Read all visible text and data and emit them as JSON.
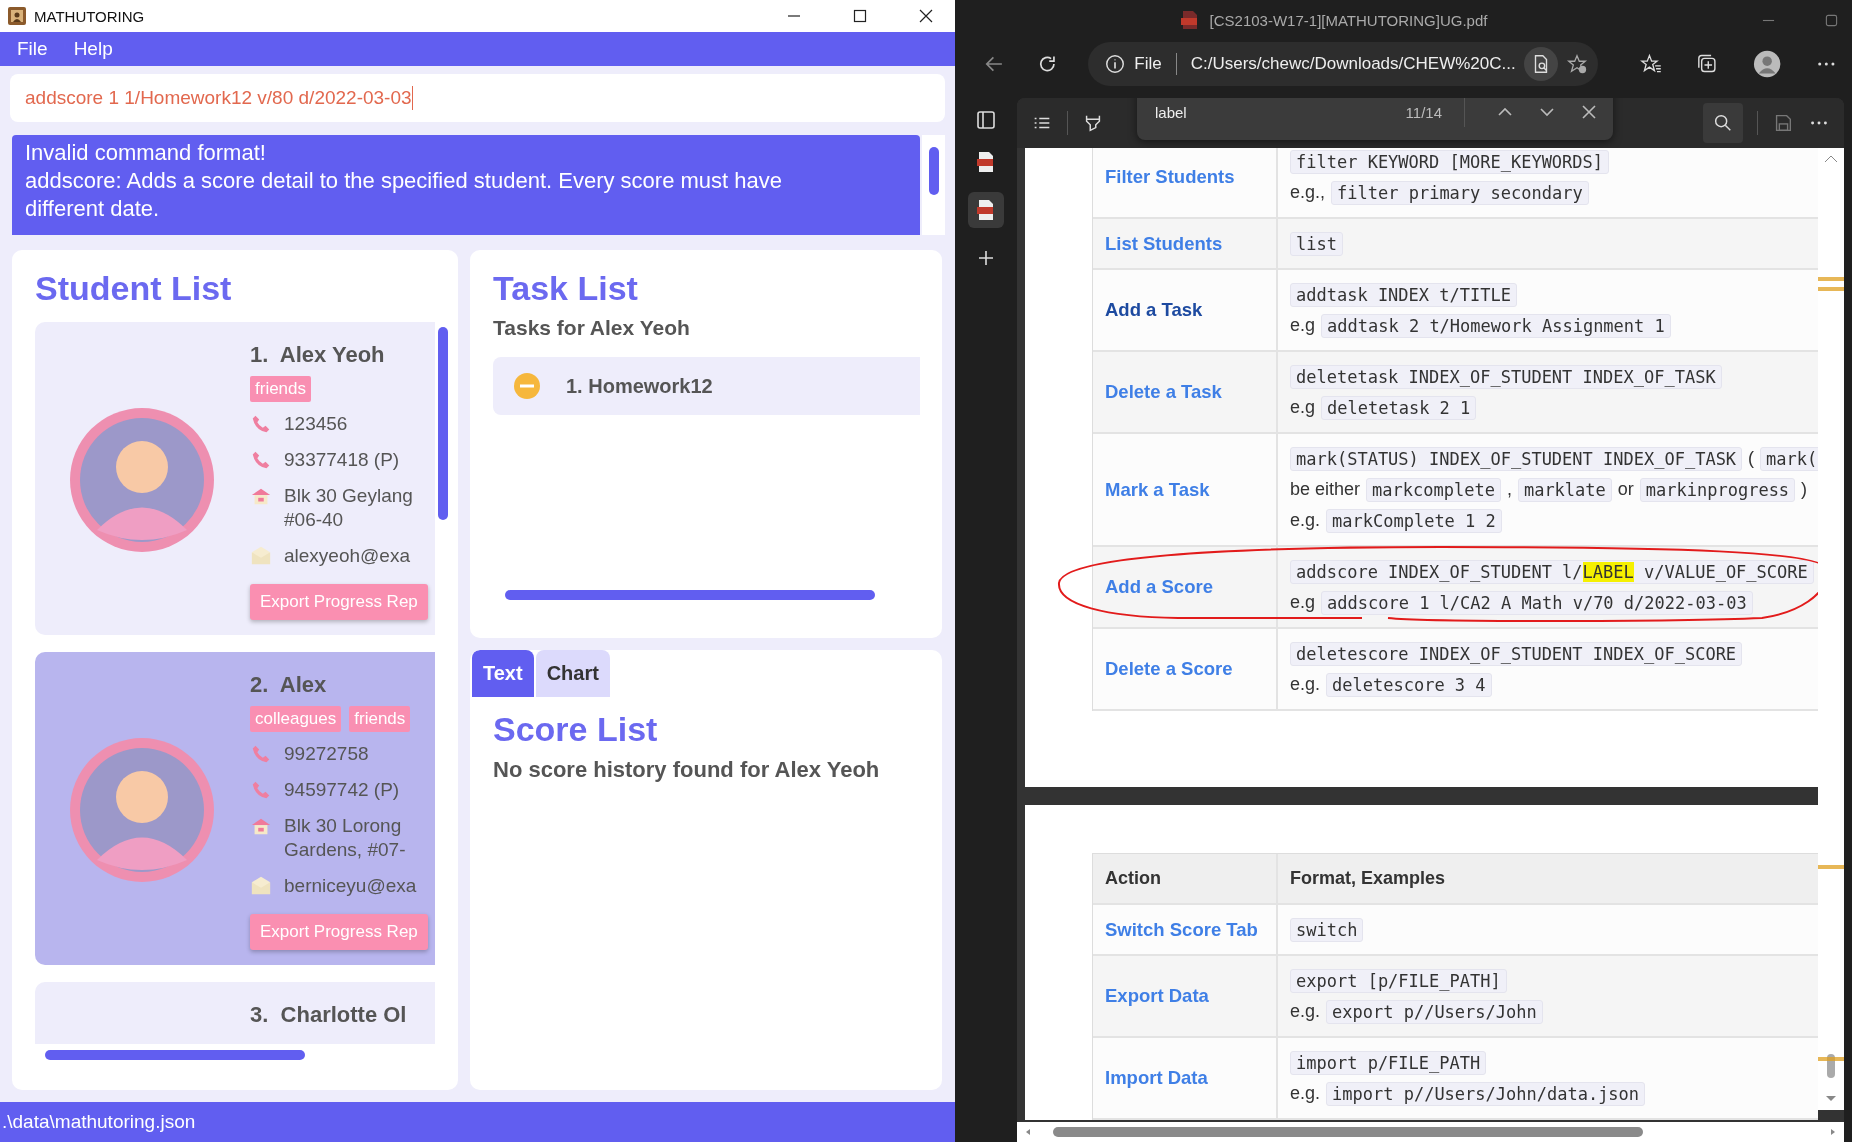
{
  "app": {
    "title": "MATHUTORING",
    "menu": [
      "File",
      "Help"
    ],
    "command": {
      "value": "addscore 1 1/Homework12 v/80 d/2022-03-03"
    },
    "result": [
      "Invalid command format!",
      "addscore: Adds a score detail to the specified student. Every score must have different date."
    ],
    "student_list": {
      "title": "Student List",
      "students": [
        {
          "index": "1.",
          "name": "Alex Yeoh",
          "selected": false,
          "tags": [
            "friends"
          ],
          "details": [
            {
              "kind": "phone",
              "lines": [
                "123456"
              ]
            },
            {
              "kind": "phone",
              "lines": [
                "93377418 (P)"
              ]
            },
            {
              "kind": "address",
              "lines": [
                "Blk 30 Geylang",
                "#06-40"
              ]
            },
            {
              "kind": "email",
              "lines": [
                "alexyeoh@exa"
              ]
            }
          ],
          "button": "Export Progress Rep"
        },
        {
          "index": "2.",
          "name": "Alex",
          "selected": true,
          "tags": [
            "colleagues",
            "friends"
          ],
          "details": [
            {
              "kind": "phone",
              "lines": [
                "99272758"
              ]
            },
            {
              "kind": "phone",
              "lines": [
                "94597742 (P)"
              ]
            },
            {
              "kind": "address",
              "lines": [
                "Blk 30 Lorong",
                "Gardens, #07-"
              ]
            },
            {
              "kind": "email",
              "lines": [
                "berniceyu@exa"
              ]
            }
          ],
          "button": "Export Progress Rep"
        },
        {
          "index": "3.",
          "name": "Charlotte Ol",
          "selected": false
        }
      ]
    },
    "task_list": {
      "title": "Task List",
      "subtitle": "Tasks for Alex Yeoh",
      "tasks": [
        {
          "label": "1. Homework12",
          "kind": "in_progress"
        }
      ]
    },
    "score_panel": {
      "tabs": [
        {
          "label": "Text",
          "selected": true
        },
        {
          "label": "Chart",
          "selected": false
        }
      ],
      "title": "Score List",
      "message": "No score history found for Alex Yeoh"
    },
    "status_bar": ".\\data\\mathutoring.json"
  },
  "browser": {
    "title": "[CS2103-W17-1][MATHUTORING]UG.pdf",
    "address": {
      "scheme": "File",
      "url": "C:/Users/chewc/Downloads/CHEW%20C..."
    },
    "find": {
      "query": "label",
      "count": "11/14"
    },
    "pages": [
      {
        "rows": [
          {
            "action": "Filter Students",
            "visited": false,
            "lines": [
              [
                {
                  "kind": "code",
                  "text": "filter KEYWORD [MORE_KEYWORDS]"
                }
              ],
              [
                {
                  "kind": "text",
                  "text": "e.g.,"
                },
                {
                  "kind": "code",
                  "text": "filter primary secondary"
                }
              ]
            ]
          },
          {
            "action": "List Students",
            "visited": false,
            "lines": [
              [
                {
                  "kind": "code",
                  "text": "list"
                }
              ]
            ]
          },
          {
            "action": "Add a Task",
            "visited": true,
            "lines": [
              [
                {
                  "kind": "code",
                  "text": "addtask INDEX t/TITLE"
                }
              ],
              [
                {
                  "kind": "text",
                  "text": "e.g"
                },
                {
                  "kind": "code",
                  "text": "addtask 2 t/Homework Assignment 1"
                }
              ]
            ]
          },
          {
            "action": "Delete a Task",
            "visited": false,
            "lines": [
              [
                {
                  "kind": "code",
                  "text": "deletetask INDEX_OF_STUDENT INDEX_OF_TASK"
                }
              ],
              [
                {
                  "kind": "text",
                  "text": "e.g"
                },
                {
                  "kind": "code",
                  "text": "deletetask 2 1"
                }
              ]
            ]
          },
          {
            "action": "Mark a Task",
            "visited": false,
            "lines": [
              [
                {
                  "kind": "code",
                  "text": "mark(STATUS) INDEX_OF_STUDENT INDEX_OF_TASK"
                },
                {
                  "kind": "text",
                  "text": "("
                },
                {
                  "kind": "code",
                  "text": "mark("
                }
              ],
              [
                {
                  "kind": "text",
                  "text": "be either"
                },
                {
                  "kind": "code",
                  "text": "markcomplete"
                },
                {
                  "kind": "text",
                  "text": ","
                },
                {
                  "kind": "code",
                  "text": "marklate"
                },
                {
                  "kind": "text",
                  "text": "or"
                },
                {
                  "kind": "code",
                  "text": "markinprogress"
                },
                {
                  "kind": "text",
                  "text": ")"
                }
              ],
              [
                {
                  "kind": "text",
                  "text": "e.g."
                },
                {
                  "kind": "code",
                  "text": "markComplete 1 2"
                }
              ]
            ]
          },
          {
            "action": "Add a Score",
            "visited": false,
            "lines": [
              [
                {
                  "kind": "code",
                  "parts": [
                    {
                      "text": "addscore INDEX_OF_STUDENT l/",
                      "match": false
                    },
                    {
                      "text": "LABEL",
                      "match": true
                    },
                    {
                      "text": " v/VALUE_OF_SCORE",
                      "match": false
                    }
                  ]
                }
              ],
              [
                {
                  "kind": "text",
                  "text": "e.g"
                },
                {
                  "kind": "code",
                  "text": "addscore 1 l/CA2 A Math v/70 d/2022-03-03"
                }
              ]
            ]
          },
          {
            "action": "Delete a Score",
            "visited": false,
            "lines": [
              [
                {
                  "kind": "code",
                  "text": "deletescore INDEX_OF_STUDENT INDEX_OF_SCORE"
                }
              ],
              [
                {
                  "kind": "text",
                  "text": "e.g."
                },
                {
                  "kind": "code",
                  "text": "deletescore 3 4"
                }
              ]
            ]
          }
        ]
      },
      {
        "columns": [
          "Action",
          "Format, Examples"
        ],
        "rows": [
          {
            "action": "Switch Score Tab",
            "visited": false,
            "lines": [
              [
                {
                  "kind": "code",
                  "text": "switch"
                }
              ]
            ]
          },
          {
            "action": "Export Data",
            "visited": false,
            "lines": [
              [
                {
                  "kind": "code",
                  "text": "export [p/FILE_PATH]"
                }
              ],
              [
                {
                  "kind": "text",
                  "text": "e.g."
                },
                {
                  "kind": "code",
                  "text": "export p//Users/John"
                }
              ]
            ]
          },
          {
            "action": "Import Data",
            "visited": false,
            "lines": [
              [
                {
                  "kind": "code",
                  "text": "import p/FILE_PATH"
                }
              ],
              [
                {
                  "kind": "text",
                  "text": "e.g."
                },
                {
                  "kind": "code",
                  "text": "import p//Users/John/data.json"
                }
              ]
            ]
          }
        ]
      }
    ]
  }
}
